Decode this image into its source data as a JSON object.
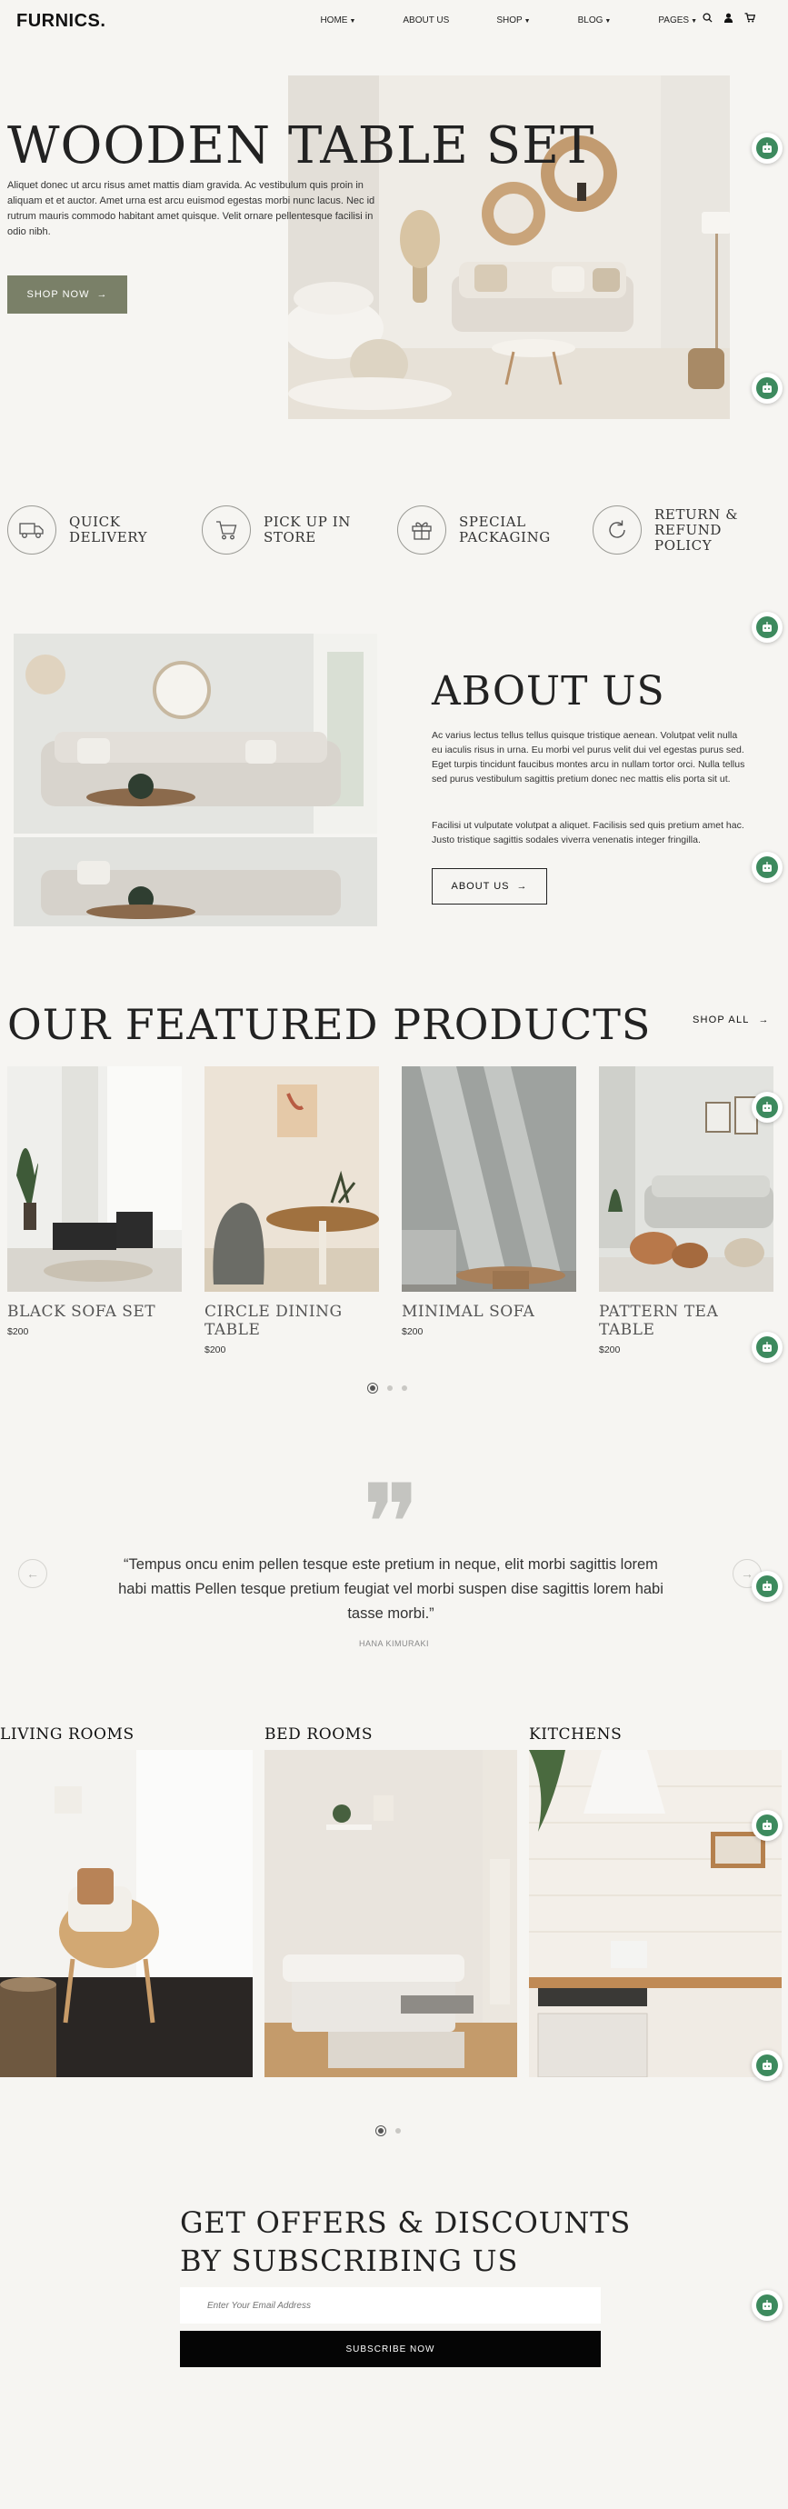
{
  "header": {
    "logo": "FURNICS.",
    "nav": [
      "HOME",
      "ABOUT US",
      "SHOP",
      "BLOG",
      "PAGES"
    ],
    "icons": [
      "search-icon",
      "user-icon",
      "cart-icon"
    ]
  },
  "hero": {
    "title": "WOODEN TABLE SET",
    "text": "Aliquet donec ut arcu risus amet mattis diam gravida. Ac vestibulum quis proin in aliquam et et auctor. Amet urna est arcu euismod egestas morbi nunc lacus. Nec id rutrum mauris commodo habitant amet quisque. Velit ornare pellentesque facilisi in odio nibh.",
    "button": "SHOP NOW"
  },
  "features": [
    {
      "icon": "truck-icon",
      "line1": "QUICK",
      "line2": "DELIVERY",
      "line3": ""
    },
    {
      "icon": "cart-icon",
      "line1": "PICK UP IN",
      "line2": "STORE",
      "line3": ""
    },
    {
      "icon": "gift-icon",
      "line1": "SPECIAL",
      "line2": "PACKAGING",
      "line3": ""
    },
    {
      "icon": "refresh-icon",
      "line1": "RETURN &",
      "line2": "REFUND",
      "line3": "POLICY"
    }
  ],
  "about": {
    "title": "ABOUT US",
    "p1": "Ac varius lectus tellus tellus quisque tristique aenean. Volutpat velit nulla eu iaculis risus in urna. Eu morbi vel purus velit dui vel egestas purus sed. Eget turpis tincidunt faucibus montes arcu in nullam tortor orci. Nulla tellus sed purus vestibulum sagittis pretium donec nec mattis elis porta sit ut.",
    "p2": "Facilisi ut vulputate volutpat a aliquet. Facilisis sed quis pretium amet hac. Justo tristique sagittis sodales viverra venenatis integer fringilla.",
    "button": "ABOUT US"
  },
  "featured": {
    "title": "OUR FEATURED PRODUCTS",
    "shop_all": "SHOP ALL",
    "products": [
      {
        "name": "BLACK SOFA SET",
        "price": "$200"
      },
      {
        "name": "CIRCLE DINING TABLE",
        "price": "$200"
      },
      {
        "name": "MINIMAL SOFA",
        "price": "$200"
      },
      {
        "name": "PATTERN TEA TABLE",
        "price": "$200"
      }
    ],
    "pagination": {
      "total": 3,
      "active": 1
    }
  },
  "testimonial": {
    "quote": "“Tempus oncu enim pellen tesque este pretium in neque, elit morbi sagittis lorem habi mattis Pellen tesque pretium feugiat vel morbi suspen dise sagittis lorem habi tasse morbi.”",
    "author": "HANA KIMURAKI"
  },
  "categories": {
    "items": [
      "LIVING ROOMS",
      "BED ROOMS",
      "KITCHENS"
    ],
    "pagination": {
      "total": 2,
      "active": 1
    }
  },
  "subscribe": {
    "title_line1": "GET OFFERS & DISCOUNTS",
    "title_line2": "BY SUBSCRIBING US",
    "placeholder": "Enter Your Email Address",
    "button": "SUBSCRIBE NOW"
  },
  "colors": {
    "background": "#f6f5f2",
    "olive_button": "#7a8068",
    "bot_green": "#3d8a5e"
  }
}
